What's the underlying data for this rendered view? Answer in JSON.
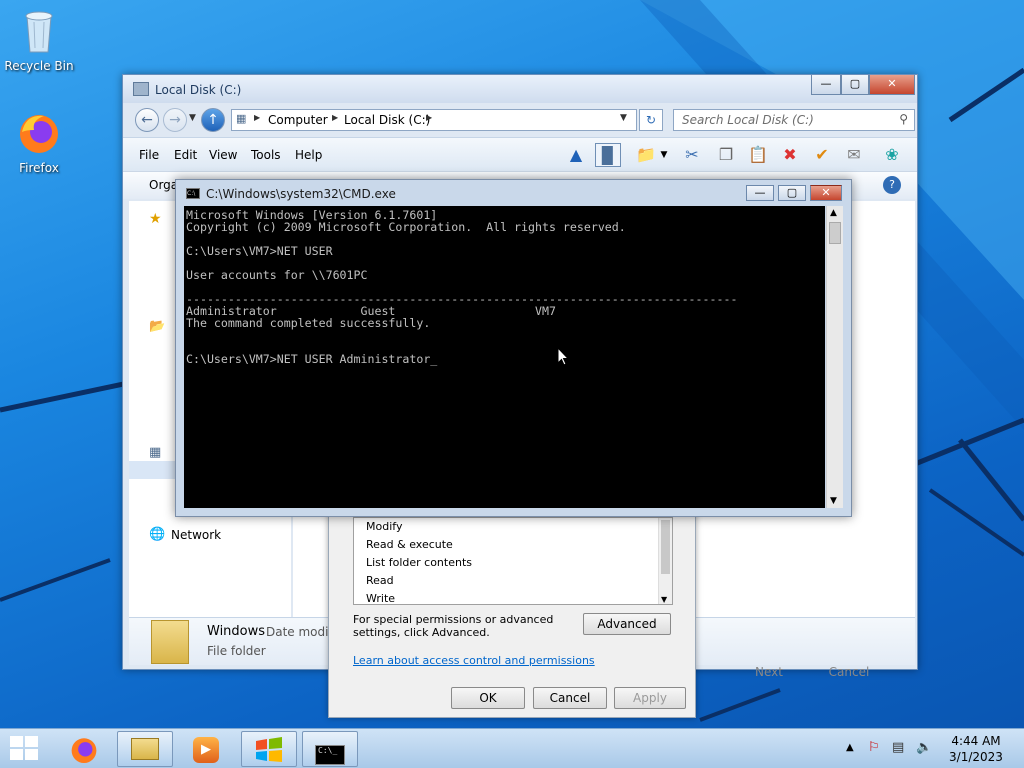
{
  "desktop": {
    "icons": [
      {
        "label": "Recycle Bin",
        "icon": "recycle-bin-icon"
      },
      {
        "label": "Firefox",
        "icon": "firefox-icon"
      }
    ]
  },
  "explorer": {
    "title": "Local Disk (C:)",
    "address": {
      "crumbs": [
        "Computer",
        "Local Disk (C:)"
      ]
    },
    "search_placeholder": "Search Local Disk (C:)",
    "menu": [
      "File",
      "Edit",
      "View",
      "Tools",
      "Help"
    ],
    "organize_label": "Orga",
    "nav": {
      "network": "Network"
    },
    "details": {
      "name": "Windows",
      "date_label": "Date modifi",
      "type": "File folder"
    },
    "behind_buttons": {
      "next": "Next",
      "cancel": "Cancel"
    }
  },
  "properties": {
    "permissions": [
      "Modify",
      "Read & execute",
      "List folder contents",
      "Read",
      "Write"
    ],
    "special_text": "For special permissions or advanced settings, click Advanced.",
    "advanced_label": "Advanced",
    "link": "Learn about access control and permissions",
    "ok_label": "OK",
    "cancel_label": "Cancel",
    "apply_label": "Apply"
  },
  "cmd": {
    "title": "C:\\Windows\\system32\\CMD.exe",
    "lines": [
      "Microsoft Windows [Version 6.1.7601]",
      "Copyright (c) 2009 Microsoft Corporation.  All rights reserved.",
      "",
      "C:\\Users\\VM7>NET USER",
      "",
      "User accounts for \\\\7601PC",
      "",
      "-------------------------------------------------------------------------------",
      "Administrator            Guest                    VM7",
      "The command completed successfully.",
      "",
      "",
      "C:\\Users\\VM7>NET USER Administrator_"
    ]
  },
  "taskbar": {
    "items": [
      "start-button",
      "firefox",
      "explorer",
      "media-player",
      "windows-explorer",
      "cmd"
    ],
    "time": "4:44 AM",
    "date": "3/1/2023"
  },
  "colors": {
    "desktop": "#1a86e0",
    "cmd_background": "#000000",
    "cmd_text": "#c0c0c0",
    "link": "#0066cc"
  }
}
